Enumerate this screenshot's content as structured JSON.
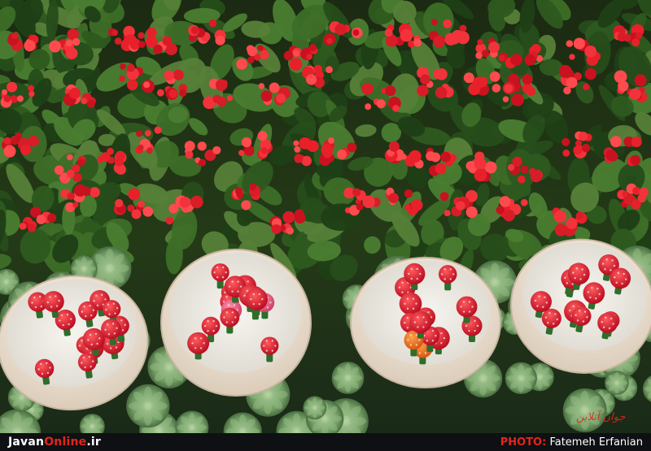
{
  "photo": {
    "subject": "flower-display",
    "colors": {
      "begonia_red": "#e8202a",
      "foliage_green": "#2f5a22",
      "pot_cream": "#efe4d6",
      "gravel_white": "#f2f0ea",
      "succulent_green": "#7aa072",
      "cactus_red": "#d9142a",
      "cactus_orange": "#ef6a1c",
      "cactus_pink": "#ea5d86"
    },
    "pots": [
      {
        "cacti": 14,
        "colors": [
          "red"
        ]
      },
      {
        "cacti": 15,
        "colors": [
          "red",
          "pink"
        ]
      },
      {
        "cacti": 13,
        "colors": [
          "red",
          "orange"
        ]
      },
      {
        "cacti": 12,
        "colors": [
          "red"
        ]
      }
    ]
  },
  "caption": {
    "site_part_a": "Javan",
    "site_part_b": "Online",
    "site_part_c": ".ir",
    "photo_label": "PHOTO:",
    "photographer": "Fatemeh Erfanian"
  },
  "watermark": {
    "text": "جوان آنلاین"
  }
}
